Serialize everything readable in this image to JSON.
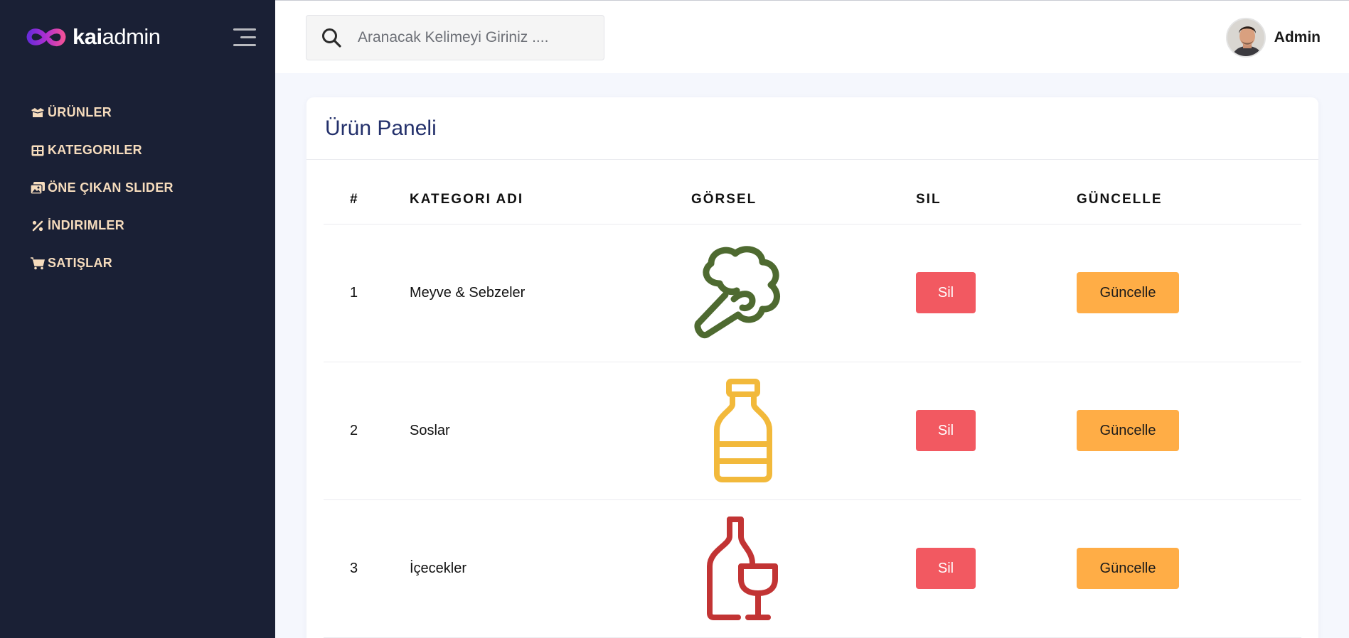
{
  "brand": {
    "name_bold": "kai",
    "name_light": "admin"
  },
  "sidebar": {
    "items": [
      {
        "label": "ÜRÜNLER",
        "icon": "box-open-icon"
      },
      {
        "label": "KATEGORILER",
        "icon": "table-grid-icon"
      },
      {
        "label": "ÖNE ÇIKAN SLIDER",
        "icon": "images-icon"
      },
      {
        "label": "İNDIRIMLER",
        "icon": "percent-icon"
      },
      {
        "label": "SATIŞLAR",
        "icon": "shopping-cart-icon"
      }
    ]
  },
  "search": {
    "placeholder": "Aranacak Kelimeyi Giriniz ...."
  },
  "user": {
    "name": "Admin"
  },
  "panel": {
    "title": "Ürün Paneli",
    "columns": [
      "#",
      "KATEGORI ADI",
      "GÖRSEL",
      "SIL",
      "GÜNCELLE"
    ],
    "rows": [
      {
        "no": "1",
        "name": "Meyve & Sebzeler",
        "image": "broccoli-icon",
        "image_color": "#4e6a30",
        "delete_label": "Sil",
        "update_label": "Güncelle"
      },
      {
        "no": "2",
        "name": "Soslar",
        "image": "sauce-bottle-icon",
        "image_color": "#f2b93b",
        "delete_label": "Sil",
        "update_label": "Güncelle"
      },
      {
        "no": "3",
        "name": "İçecekler",
        "image": "wine-bottle-glass-icon",
        "image_color": "#c23434",
        "delete_label": "Sil",
        "update_label": "Güncelle"
      }
    ]
  },
  "colors": {
    "sidebar_bg": "#1a2035",
    "nav_text": "#f6dcbd",
    "title": "#23306b",
    "delete_button": "#f25961",
    "update_button": "#ffad46"
  }
}
